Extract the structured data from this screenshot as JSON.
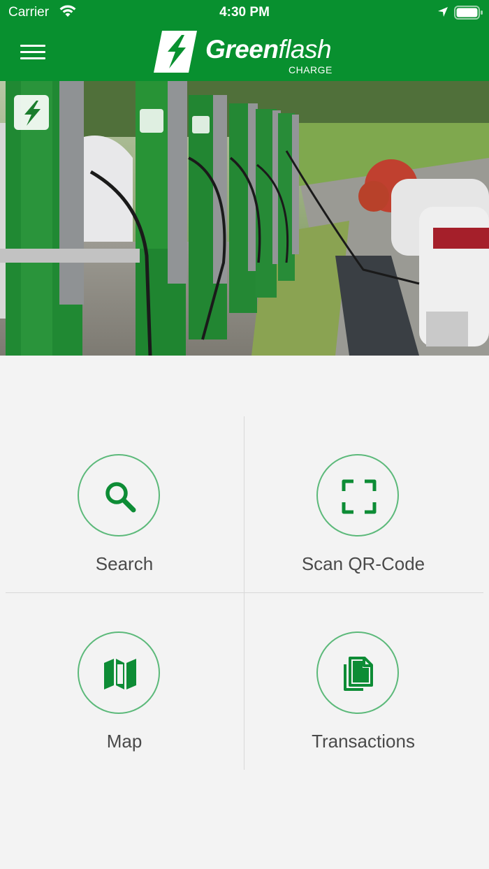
{
  "status_bar": {
    "carrier": "Carrier",
    "time": "4:30 PM"
  },
  "header": {
    "brand_part1": "Green",
    "brand_part2": "flash",
    "brand_sub": "CHARGE",
    "color": "#08902f"
  },
  "menu": {
    "items": [
      {
        "label": "Search",
        "icon": "search-icon"
      },
      {
        "label": "Scan QR-Code",
        "icon": "qr-scan-icon"
      },
      {
        "label": "Map",
        "icon": "map-icon"
      },
      {
        "label": "Transactions",
        "icon": "documents-icon"
      }
    ]
  },
  "colors": {
    "brand_green": "#08902f",
    "icon_green": "#0d8c35",
    "circle_border": "#5cb97a",
    "background": "#f3f3f3"
  }
}
